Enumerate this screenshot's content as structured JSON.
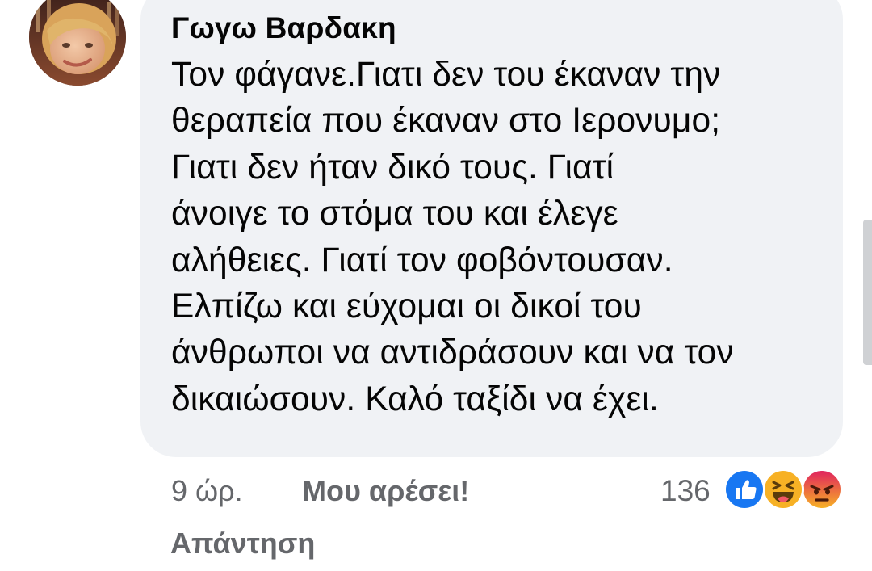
{
  "comment": {
    "author": "Γωγω Βαρδακη",
    "text_lines": [
      "Τον φάγανε.Γιατι δεν του έκαναν την",
      "θεραπεία που έκαναν στο Ιερονυμο;",
      "Γιατι δεν ήταν δικό τους. Γιατί",
      "άνοιγε το στόμα του και έλεγε",
      "αλήθειες. Γιατί τον φοβόντουσαν.",
      "Ελπίζω και εύχομαι οι δικοί του",
      "άνθρωποι να αντιδράσουν και να τον",
      "δικαιώσουν. Καλό ταξίδι να έχει."
    ],
    "timestamp": "9 ώρ.",
    "like_label": "Μου αρέσει!",
    "reply_label": "Απάντηση",
    "reaction_count": "136",
    "reactions": [
      "like-icon",
      "haha-icon",
      "angry-icon"
    ]
  },
  "colors": {
    "bubble": "#f0f2f5",
    "text": "#050505",
    "secondary": "#65676b",
    "like_blue": "#1877f2",
    "haha_yellow": "#f7b125",
    "angry_orange": "#e9710f"
  }
}
